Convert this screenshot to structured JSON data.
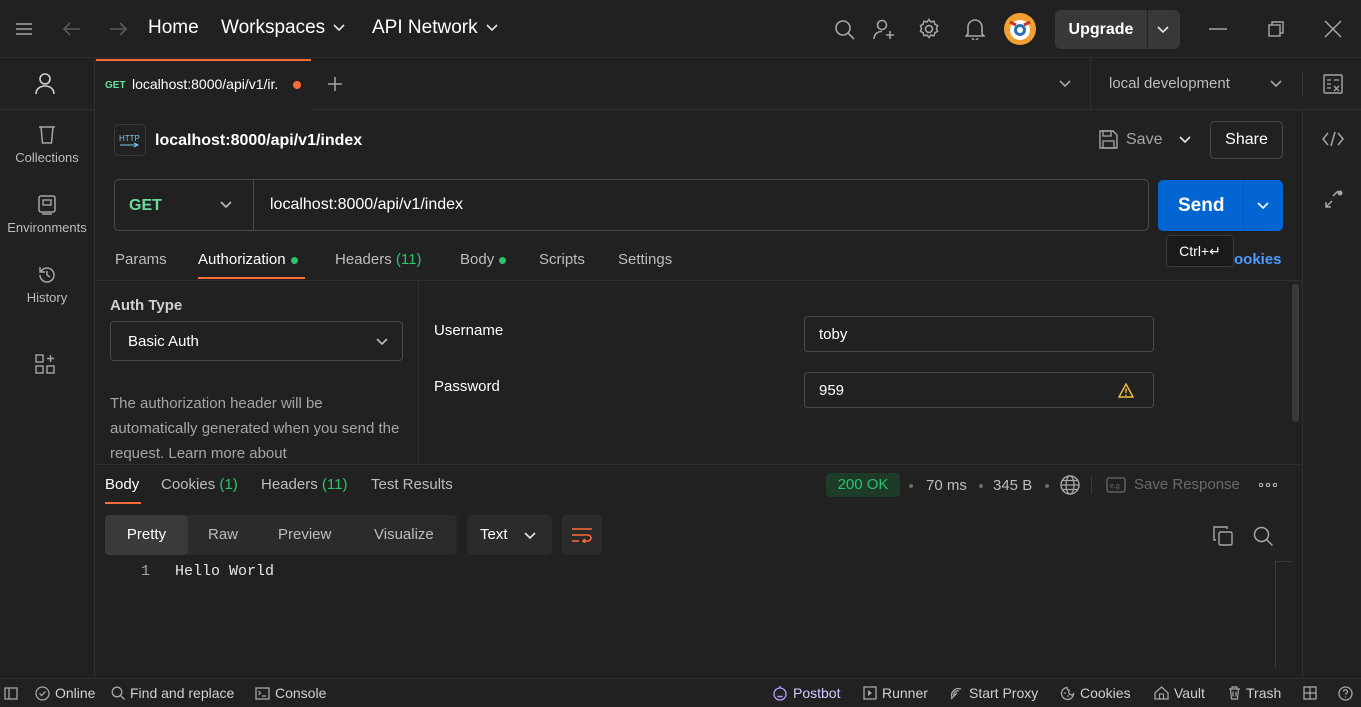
{
  "titlebar": {
    "home": "Home",
    "workspaces": "Workspaces",
    "api_network": "API Network",
    "upgrade": "Upgrade"
  },
  "sidebar": {
    "items": [
      {
        "label": "Collections"
      },
      {
        "label": "Environments"
      },
      {
        "label": "History"
      }
    ]
  },
  "tabs": {
    "active": {
      "method": "GET",
      "title": "localhost:8000/api/v1/ir."
    },
    "environment": "local development"
  },
  "request": {
    "name": "localhost:8000/api/v1/index",
    "save": "Save",
    "share": "Share",
    "method": "GET",
    "url": "localhost:8000/api/v1/index",
    "send": "Send",
    "send_tooltip": "Ctrl+↵",
    "cookies_link": "ookies",
    "tabs": {
      "params": "Params",
      "authorization": "Authorization",
      "headers": "Headers",
      "headers_count": "(11)",
      "body": "Body",
      "scripts": "Scripts",
      "settings": "Settings"
    }
  },
  "auth": {
    "type_label": "Auth Type",
    "type_value": "Basic Auth",
    "help": "The authorization header will be automatically generated when you send the request. Learn more about",
    "username_label": "Username",
    "username_value": "toby",
    "password_label": "Password",
    "password_value": "959"
  },
  "response": {
    "tabs": {
      "body": "Body",
      "cookies": "Cookies",
      "cookies_count": "(1)",
      "headers": "Headers",
      "headers_count": "(11)",
      "test_results": "Test Results"
    },
    "status": "200 OK",
    "time": "70 ms",
    "size": "345 B",
    "save_response": "Save Response",
    "views": {
      "pretty": "Pretty",
      "raw": "Raw",
      "preview": "Preview",
      "visualize": "Visualize"
    },
    "format": "Text",
    "lines": [
      {
        "num": "1",
        "text": "Hello World"
      }
    ]
  },
  "statusbar": {
    "online": "Online",
    "find_replace": "Find and replace",
    "console": "Console",
    "postbot": "Postbot",
    "runner": "Runner",
    "start_proxy": "Start Proxy",
    "cookies": "Cookies",
    "vault": "Vault",
    "trash": "Trash"
  },
  "colors": {
    "accent_orange": "#ff6c37",
    "send_blue": "#0265d2",
    "status_green": "#2dc26b",
    "link_blue": "#4c9bff"
  }
}
